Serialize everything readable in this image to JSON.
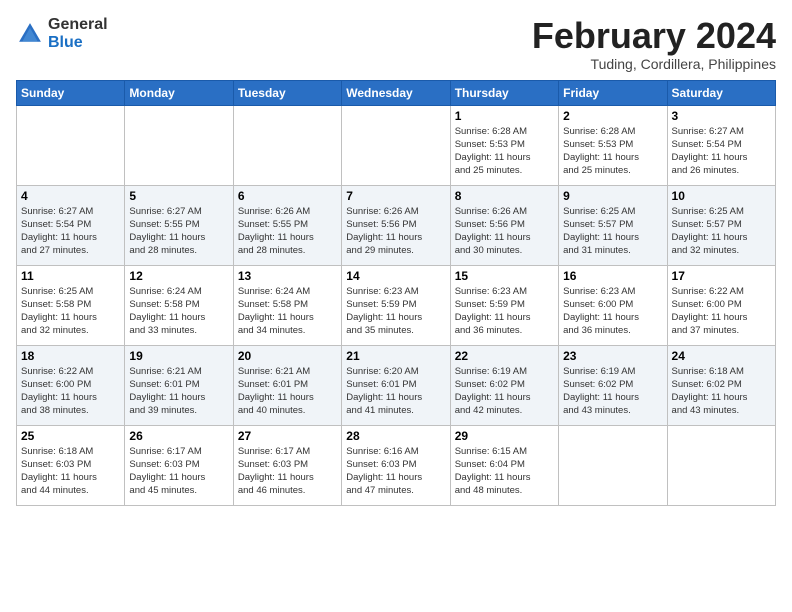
{
  "logo": {
    "general": "General",
    "blue": "Blue"
  },
  "title": "February 2024",
  "location": "Tuding, Cordillera, Philippines",
  "days_of_week": [
    "Sunday",
    "Monday",
    "Tuesday",
    "Wednesday",
    "Thursday",
    "Friday",
    "Saturday"
  ],
  "weeks": [
    [
      {
        "day": "",
        "detail": ""
      },
      {
        "day": "",
        "detail": ""
      },
      {
        "day": "",
        "detail": ""
      },
      {
        "day": "",
        "detail": ""
      },
      {
        "day": "1",
        "detail": "Sunrise: 6:28 AM\nSunset: 5:53 PM\nDaylight: 11 hours\nand 25 minutes."
      },
      {
        "day": "2",
        "detail": "Sunrise: 6:28 AM\nSunset: 5:53 PM\nDaylight: 11 hours\nand 25 minutes."
      },
      {
        "day": "3",
        "detail": "Sunrise: 6:27 AM\nSunset: 5:54 PM\nDaylight: 11 hours\nand 26 minutes."
      }
    ],
    [
      {
        "day": "4",
        "detail": "Sunrise: 6:27 AM\nSunset: 5:54 PM\nDaylight: 11 hours\nand 27 minutes."
      },
      {
        "day": "5",
        "detail": "Sunrise: 6:27 AM\nSunset: 5:55 PM\nDaylight: 11 hours\nand 28 minutes."
      },
      {
        "day": "6",
        "detail": "Sunrise: 6:26 AM\nSunset: 5:55 PM\nDaylight: 11 hours\nand 28 minutes."
      },
      {
        "day": "7",
        "detail": "Sunrise: 6:26 AM\nSunset: 5:56 PM\nDaylight: 11 hours\nand 29 minutes."
      },
      {
        "day": "8",
        "detail": "Sunrise: 6:26 AM\nSunset: 5:56 PM\nDaylight: 11 hours\nand 30 minutes."
      },
      {
        "day": "9",
        "detail": "Sunrise: 6:25 AM\nSunset: 5:57 PM\nDaylight: 11 hours\nand 31 minutes."
      },
      {
        "day": "10",
        "detail": "Sunrise: 6:25 AM\nSunset: 5:57 PM\nDaylight: 11 hours\nand 32 minutes."
      }
    ],
    [
      {
        "day": "11",
        "detail": "Sunrise: 6:25 AM\nSunset: 5:58 PM\nDaylight: 11 hours\nand 32 minutes."
      },
      {
        "day": "12",
        "detail": "Sunrise: 6:24 AM\nSunset: 5:58 PM\nDaylight: 11 hours\nand 33 minutes."
      },
      {
        "day": "13",
        "detail": "Sunrise: 6:24 AM\nSunset: 5:58 PM\nDaylight: 11 hours\nand 34 minutes."
      },
      {
        "day": "14",
        "detail": "Sunrise: 6:23 AM\nSunset: 5:59 PM\nDaylight: 11 hours\nand 35 minutes."
      },
      {
        "day": "15",
        "detail": "Sunrise: 6:23 AM\nSunset: 5:59 PM\nDaylight: 11 hours\nand 36 minutes."
      },
      {
        "day": "16",
        "detail": "Sunrise: 6:23 AM\nSunset: 6:00 PM\nDaylight: 11 hours\nand 36 minutes."
      },
      {
        "day": "17",
        "detail": "Sunrise: 6:22 AM\nSunset: 6:00 PM\nDaylight: 11 hours\nand 37 minutes."
      }
    ],
    [
      {
        "day": "18",
        "detail": "Sunrise: 6:22 AM\nSunset: 6:00 PM\nDaylight: 11 hours\nand 38 minutes."
      },
      {
        "day": "19",
        "detail": "Sunrise: 6:21 AM\nSunset: 6:01 PM\nDaylight: 11 hours\nand 39 minutes."
      },
      {
        "day": "20",
        "detail": "Sunrise: 6:21 AM\nSunset: 6:01 PM\nDaylight: 11 hours\nand 40 minutes."
      },
      {
        "day": "21",
        "detail": "Sunrise: 6:20 AM\nSunset: 6:01 PM\nDaylight: 11 hours\nand 41 minutes."
      },
      {
        "day": "22",
        "detail": "Sunrise: 6:19 AM\nSunset: 6:02 PM\nDaylight: 11 hours\nand 42 minutes."
      },
      {
        "day": "23",
        "detail": "Sunrise: 6:19 AM\nSunset: 6:02 PM\nDaylight: 11 hours\nand 43 minutes."
      },
      {
        "day": "24",
        "detail": "Sunrise: 6:18 AM\nSunset: 6:02 PM\nDaylight: 11 hours\nand 43 minutes."
      }
    ],
    [
      {
        "day": "25",
        "detail": "Sunrise: 6:18 AM\nSunset: 6:03 PM\nDaylight: 11 hours\nand 44 minutes."
      },
      {
        "day": "26",
        "detail": "Sunrise: 6:17 AM\nSunset: 6:03 PM\nDaylight: 11 hours\nand 45 minutes."
      },
      {
        "day": "27",
        "detail": "Sunrise: 6:17 AM\nSunset: 6:03 PM\nDaylight: 11 hours\nand 46 minutes."
      },
      {
        "day": "28",
        "detail": "Sunrise: 6:16 AM\nSunset: 6:03 PM\nDaylight: 11 hours\nand 47 minutes."
      },
      {
        "day": "29",
        "detail": "Sunrise: 6:15 AM\nSunset: 6:04 PM\nDaylight: 11 hours\nand 48 minutes."
      },
      {
        "day": "",
        "detail": ""
      },
      {
        "day": "",
        "detail": ""
      }
    ]
  ]
}
